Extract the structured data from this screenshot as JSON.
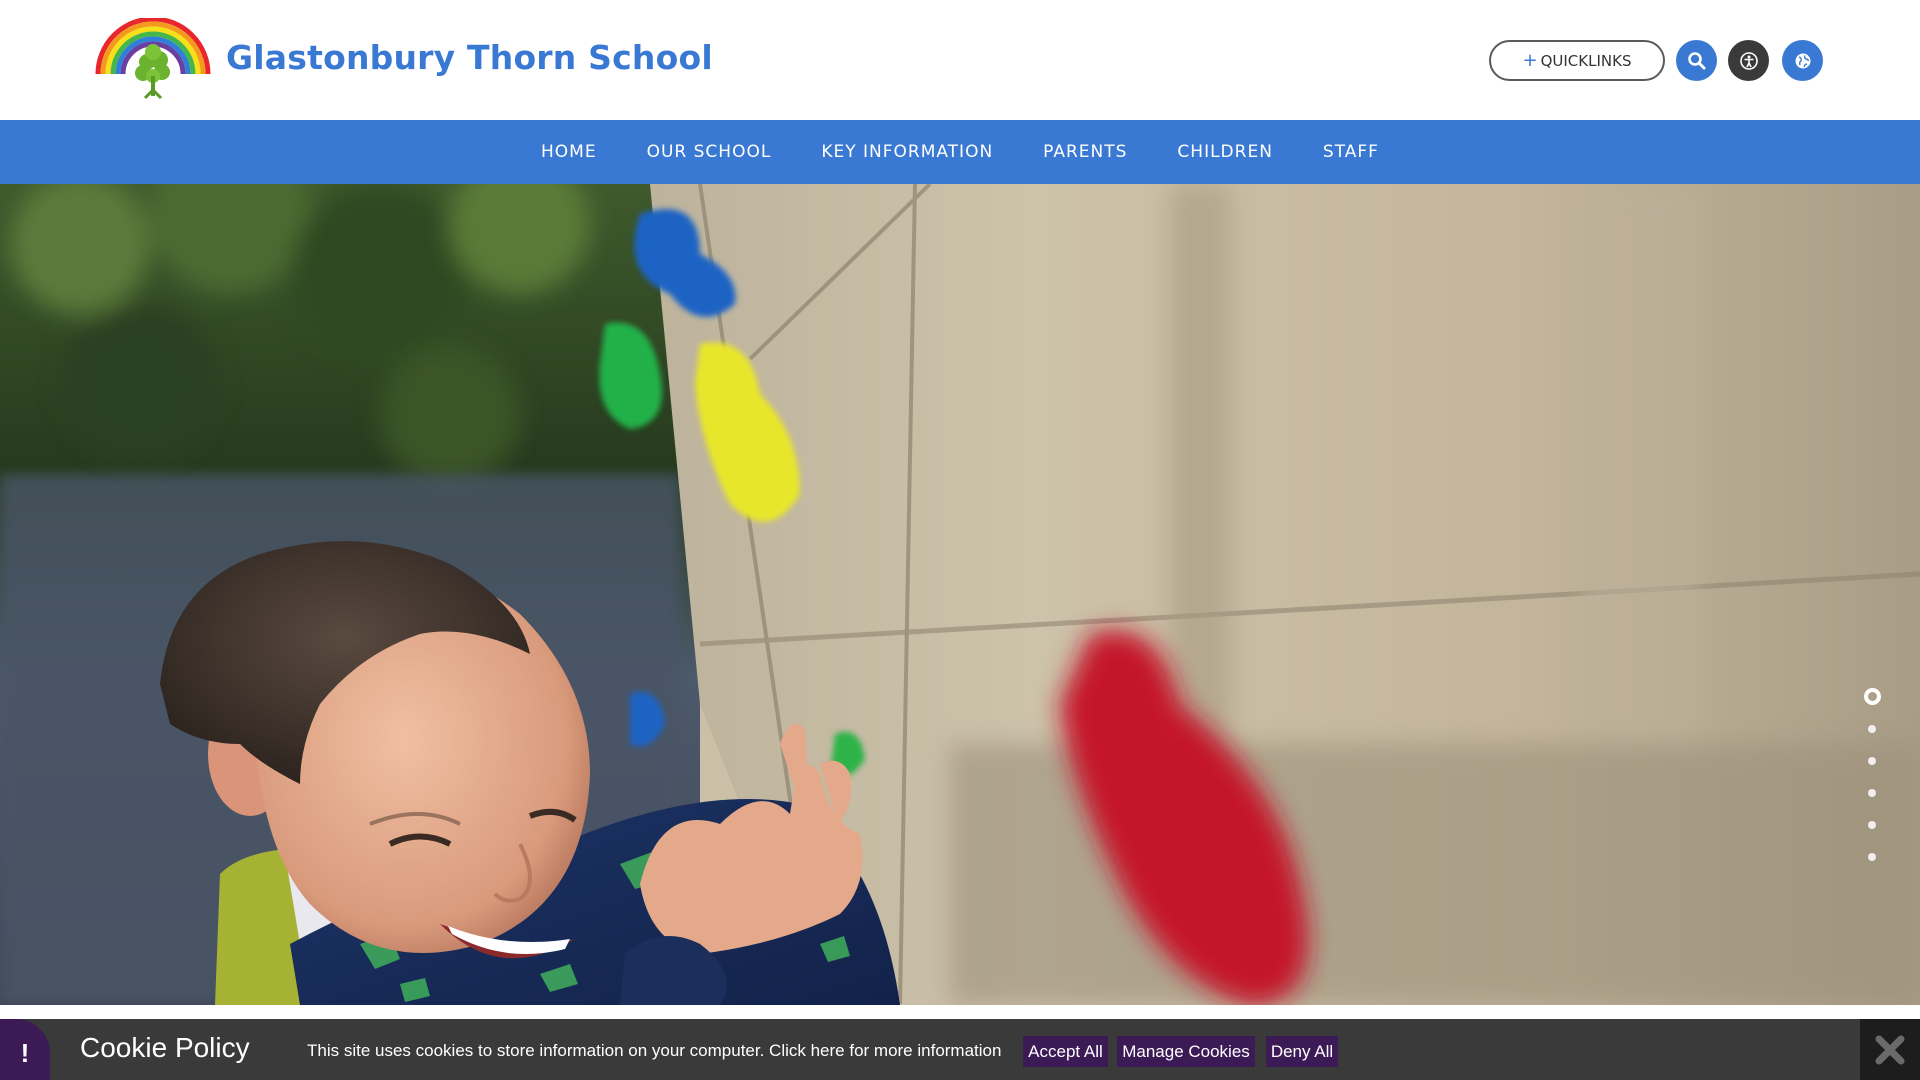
{
  "header": {
    "school_name": "Glastonbury Thorn School",
    "quicklinks_label": "QUICKLINKS",
    "quicklinks_icon": "plus-icon",
    "search_icon": "search-icon",
    "accessibility_icon": "accessibility-icon",
    "translate_icon": "globe-icon",
    "logo_icon": "rainbow-tree-logo"
  },
  "nav": {
    "items": [
      {
        "label": "HOME"
      },
      {
        "label": "OUR SCHOOL"
      },
      {
        "label": "KEY INFORMATION"
      },
      {
        "label": "PARENTS"
      },
      {
        "label": "CHILDREN"
      },
      {
        "label": "STAFF"
      }
    ]
  },
  "hero": {
    "slide_count": 6,
    "active_slide": 1
  },
  "cookie": {
    "title": "Cookie Policy",
    "text": "This site uses cookies to store information on your computer. Click here for more information",
    "accept_label": "Accept All",
    "manage_label": "Manage Cookies",
    "deny_label": "Deny All",
    "warning_glyph": "!",
    "close_icon": "close-icon"
  },
  "colors": {
    "brand_blue": "#3a79d3",
    "cookie_bar": "#3a3a3a",
    "cookie_button": "#3c1a56"
  }
}
